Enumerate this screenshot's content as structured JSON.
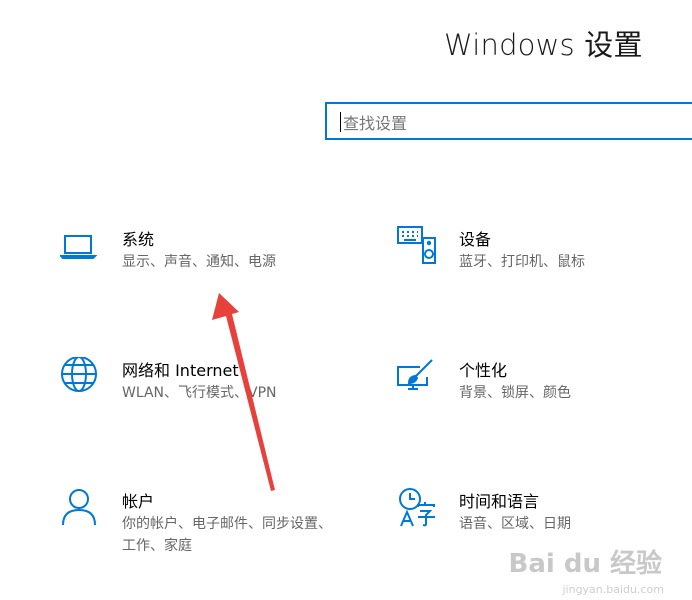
{
  "title": "Windows 设置",
  "search": {
    "placeholder": "查找设置"
  },
  "tiles": [
    {
      "name": "系统",
      "desc": "显示、声音、通知、电源",
      "icon": "laptop-icon"
    },
    {
      "name": "设备",
      "desc": "蓝牙、打印机、鼠标",
      "icon": "keyboard-speaker-icon"
    },
    {
      "name": "网络和 Internet",
      "desc": "WLAN、飞行模式、VPN",
      "icon": "globe-icon"
    },
    {
      "name": "个性化",
      "desc": "背景、锁屏、颜色",
      "icon": "paint-brush-icon"
    },
    {
      "name": "帐户",
      "desc": "你的帐户、电子邮件、同步设置、工作、家庭",
      "icon": "person-icon"
    },
    {
      "name": "时间和语言",
      "desc": "语音、区域、日期",
      "icon": "time-language-icon"
    }
  ],
  "colors": {
    "accent": "#0078d7",
    "arrow": "#e8413c"
  },
  "watermark": {
    "brand": "Bai du 经验",
    "url": "jingyan.baidu.com"
  }
}
